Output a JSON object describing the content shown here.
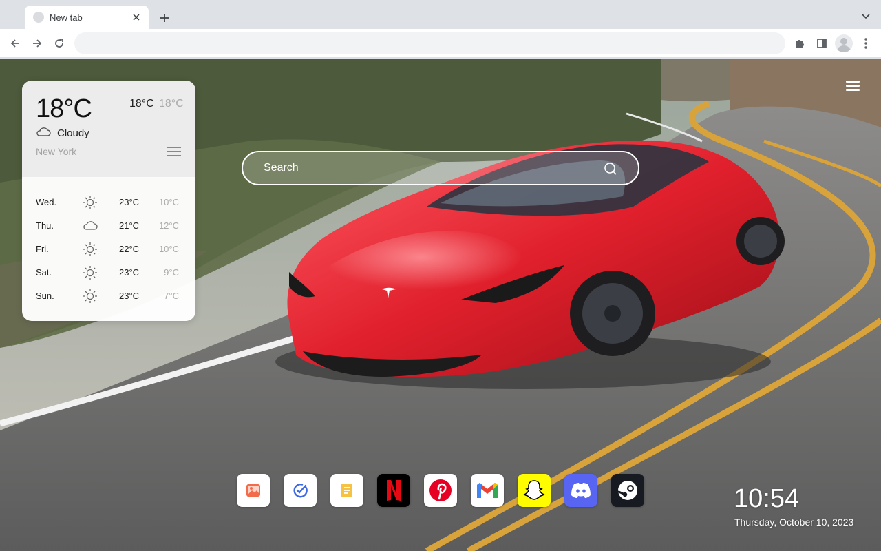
{
  "browser": {
    "tab": {
      "title": "New tab"
    },
    "omnibox": {
      "value": "",
      "placeholder": ""
    }
  },
  "weather": {
    "current_temp": "18°C",
    "high": "18°C",
    "low": "18°C",
    "condition": "Cloudy",
    "condition_icon": "cloud-icon",
    "city": "New York",
    "forecast": [
      {
        "day": "Wed.",
        "icon": "sun-icon",
        "high": "23°C",
        "low": "10°C"
      },
      {
        "day": "Thu.",
        "icon": "cloud-icon",
        "high": "21°C",
        "low": "12°C"
      },
      {
        "day": "Fri.",
        "icon": "sun-icon",
        "high": "22°C",
        "low": "10°C"
      },
      {
        "day": "Sat.",
        "icon": "sun-icon",
        "high": "23°C",
        "low": "9°C"
      },
      {
        "day": "Sun.",
        "icon": "sun-icon",
        "high": "23°C",
        "low": "7°C"
      }
    ]
  },
  "search": {
    "placeholder": "Search"
  },
  "dock": [
    {
      "name": "photos",
      "icon": "photos-icon",
      "bg": "#ffffff"
    },
    {
      "name": "tasks",
      "icon": "tasks-icon",
      "bg": "#ffffff"
    },
    {
      "name": "notes",
      "icon": "notes-icon",
      "bg": "#ffffff"
    },
    {
      "name": "netflix",
      "icon": "netflix-icon",
      "bg": "#000000"
    },
    {
      "name": "pinterest",
      "icon": "pinterest-icon",
      "bg": "#ffffff"
    },
    {
      "name": "gmail",
      "icon": "gmail-icon",
      "bg": "#ffffff"
    },
    {
      "name": "snapchat",
      "icon": "snapchat-icon",
      "bg": "#fffc00"
    },
    {
      "name": "discord",
      "icon": "discord-icon",
      "bg": "#5865f2"
    },
    {
      "name": "steam",
      "icon": "steam-icon",
      "bg": "#171a21"
    }
  ],
  "clock": {
    "time": "10:54",
    "date": "Thursday, October 10, 2023"
  },
  "colors": {
    "accent_red": "#e0202c",
    "road_yellow": "#d9a33c",
    "chrome_bg": "#dee1e6"
  }
}
